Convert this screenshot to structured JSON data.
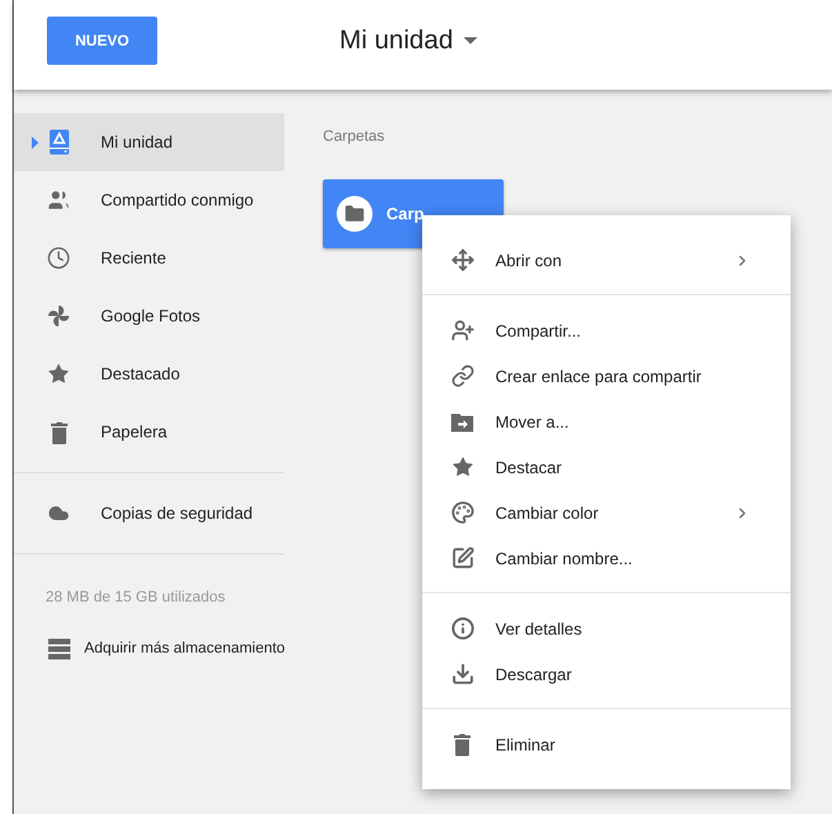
{
  "header": {
    "new_button": "NUEVO",
    "title": "Mi unidad"
  },
  "sidebar": {
    "items": [
      {
        "label": "Mi unidad",
        "kind": "drive",
        "selected": true
      },
      {
        "label": "Compartido conmigo",
        "kind": "people",
        "selected": false
      },
      {
        "label": "Reciente",
        "kind": "clock",
        "selected": false
      },
      {
        "label": "Google Fotos",
        "kind": "pinwheel",
        "selected": false
      },
      {
        "label": "Destacado",
        "kind": "star",
        "selected": false
      },
      {
        "label": "Papelera",
        "kind": "trash",
        "selected": false
      }
    ],
    "backup": {
      "label": "Copias de seguridad",
      "kind": "cloud"
    },
    "storage": "28 MB de 15 GB utilizados",
    "buy": {
      "label": "Adquirir más almacenamiento",
      "kind": "storage"
    }
  },
  "content": {
    "section_title": "Carpetas",
    "folder": {
      "name": "Carp",
      "selected": true
    }
  },
  "context_menu": {
    "sections": [
      [
        {
          "label": "Abrir con",
          "kind": "move",
          "submenu": true
        }
      ],
      [
        {
          "label": "Compartir...",
          "kind": "share",
          "submenu": false
        },
        {
          "label": "Crear enlace para compartir",
          "kind": "link",
          "submenu": false
        },
        {
          "label": "Mover a...",
          "kind": "moveto",
          "submenu": false
        },
        {
          "label": "Destacar",
          "kind": "star",
          "submenu": false
        },
        {
          "label": "Cambiar color",
          "kind": "palette",
          "submenu": true
        },
        {
          "label": "Cambiar nombre...",
          "kind": "rename",
          "submenu": false
        }
      ],
      [
        {
          "label": "Ver detalles",
          "kind": "info",
          "submenu": false
        },
        {
          "label": "Descargar",
          "kind": "download",
          "submenu": false
        }
      ],
      [
        {
          "label": "Eliminar",
          "kind": "trash",
          "submenu": false
        }
      ]
    ]
  }
}
